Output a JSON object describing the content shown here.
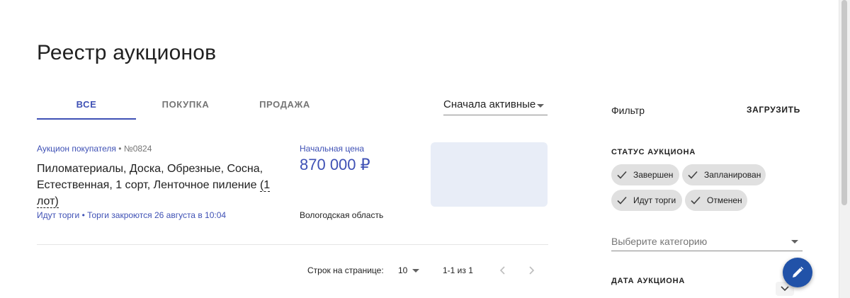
{
  "page": {
    "title": "Реестр аукционов"
  },
  "tabs": [
    {
      "label": "ВСЕ",
      "active": true
    },
    {
      "label": "ПОКУПКА",
      "active": false
    },
    {
      "label": "ПРОДАЖА",
      "active": false
    }
  ],
  "sort": {
    "selected": "Сначала активные"
  },
  "auction": {
    "type": "Аукцион покупателя",
    "separator": "•",
    "number": "№0824",
    "title": "Пиломатериалы, Доска, Обрезные, Сосна, Естественная, 1 сорт, Ленточное пиление",
    "lots": "(1 лот)",
    "status": "Идут торги • Торги закроются 26 августа в 10:04",
    "price_label": "Начальная цена",
    "price": "870 000 ₽",
    "region": "Вологодская область"
  },
  "pagination": {
    "rows_label": "Строк на странице:",
    "rows_per_page": "10",
    "range": "1-1 из 1"
  },
  "filter": {
    "title": "Фильтр",
    "load_button": "ЗАГРУЗИТЬ",
    "status_section": "СТАТУС АУКЦИОНА",
    "status_chips": [
      "Завершен",
      "Запланирован",
      "Идут торги",
      "Отменен"
    ],
    "category_placeholder": "Выберите категорию",
    "date_section": "ДАТА АУКЦИОНА"
  },
  "colors": {
    "accent": "#3f51b5",
    "chip_bg": "#e0e0e0",
    "thumb_bg": "#e8edf7",
    "fab_bg": "#2152a8"
  },
  "icons": [
    "check-icon",
    "chevron-left-icon",
    "chevron-right-icon",
    "pencil-icon",
    "chevron-down-icon"
  ]
}
